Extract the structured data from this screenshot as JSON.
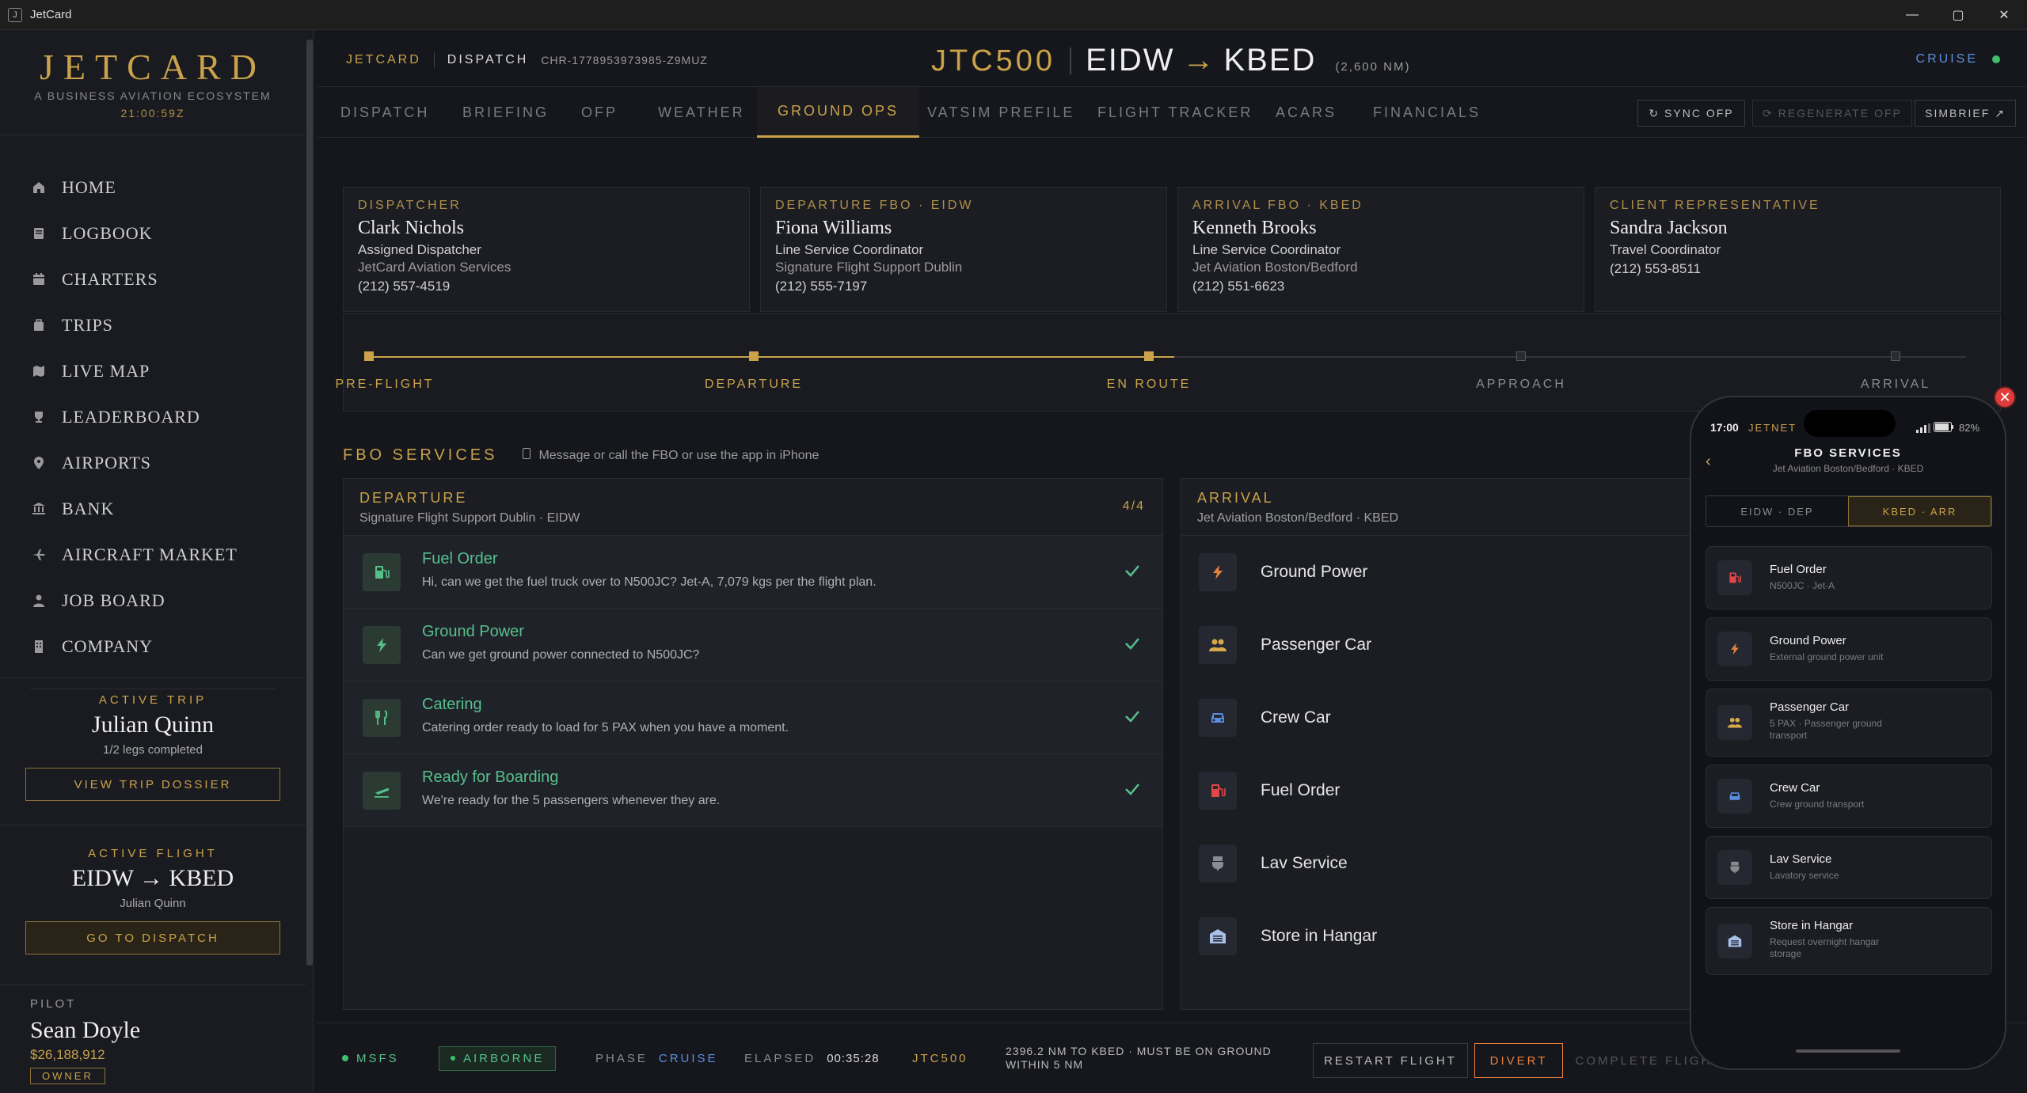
{
  "window": {
    "title": "JetCard"
  },
  "sidebar": {
    "logo": "JETCARD",
    "tagline": "A BUSINESS AVIATION ECOSYSTEM",
    "clock": "21:00:59Z",
    "nav": [
      {
        "label": "HOME",
        "icon": "home-icon"
      },
      {
        "label": "LOGBOOK",
        "icon": "book-icon"
      },
      {
        "label": "CHARTERS",
        "icon": "calendar-icon"
      },
      {
        "label": "TRIPS",
        "icon": "luggage-icon"
      },
      {
        "label": "LIVE MAP",
        "icon": "map-icon"
      },
      {
        "label": "LEADERBOARD",
        "icon": "trophy-icon"
      },
      {
        "label": "AIRPORTS",
        "icon": "pin-icon"
      },
      {
        "label": "BANK",
        "icon": "bank-icon"
      },
      {
        "label": "AIRCRAFT MARKET",
        "icon": "plane-icon"
      },
      {
        "label": "JOB BOARD",
        "icon": "person-icon"
      },
      {
        "label": "COMPANY",
        "icon": "building-icon"
      }
    ],
    "active_trip": {
      "caption": "ACTIVE TRIP",
      "name": "Julian Quinn",
      "legs": "1/2 legs completed",
      "button": "VIEW TRIP DOSSIER"
    },
    "active_flight": {
      "caption": "ACTIVE FLIGHT",
      "route": "EIDW → KBED",
      "pax": "Julian Quinn",
      "button": "GO TO DISPATCH"
    },
    "pilot": {
      "caption": "PILOT",
      "name": "Sean Doyle",
      "balance": "$26,188,912",
      "role": "OWNER"
    }
  },
  "header": {
    "crumb1": "JETCARD",
    "crumb2": "DISPATCH",
    "charter_id": "CHR-1778953973985-Z9MUZ",
    "callsign": "JTC500",
    "origin": "EIDW",
    "arrow": "→",
    "dest": "KBED",
    "distance": "(2,600 NM)",
    "phase": "CRUISE"
  },
  "tabs": [
    "DISPATCH",
    "BRIEFING",
    "OFP",
    "WEATHER",
    "GROUND OPS",
    "VATSIM PREFILE",
    "FLIGHT TRACKER",
    "ACARS",
    "FINANCIALS"
  ],
  "tab_buttons": {
    "sync": "↻ SYNC OFP",
    "regen": "⟳ REGENERATE OFP",
    "simbrief": "SIMBRIEF ↗"
  },
  "contacts": [
    {
      "caption": "DISPATCHER",
      "name": "Clark Nichols",
      "role": "Assigned Dispatcher",
      "org": "JetCard Aviation Services",
      "phone": "(212) 557-4519"
    },
    {
      "caption": "DEPARTURE FBO · EIDW",
      "name": "Fiona Williams",
      "role": "Line Service Coordinator",
      "org": "Signature Flight Support Dublin",
      "phone": "(212) 555-7197"
    },
    {
      "caption": "ARRIVAL FBO · KBED",
      "name": "Kenneth Brooks",
      "role": "Line Service Coordinator",
      "org": "Jet Aviation Boston/Bedford",
      "phone": "(212) 551-6623"
    },
    {
      "caption": "CLIENT REPRESENTATIVE",
      "name": "Sandra Jackson",
      "role": "Travel Coordinator",
      "org": "",
      "phone": "(212) 553-8511"
    }
  ],
  "progress": {
    "stages": [
      "PRE-FLIGHT",
      "DEPARTURE",
      "EN ROUTE",
      "APPROACH",
      "ARRIVAL"
    ],
    "completed_through": 3
  },
  "fbo": {
    "title": "FBO SERVICES",
    "note": "Message or call the FBO or use the app in iPhone",
    "departure": {
      "title": "DEPARTURE",
      "subtitle": "Signature Flight Support Dublin · EIDW",
      "count": "4/4",
      "items": [
        {
          "title": "Fuel Order",
          "desc": "Hi, can we get the fuel truck over to N500JC? Jet-A, 7,079 kgs per the flight plan.",
          "icon": "fuel-icon"
        },
        {
          "title": "Ground Power",
          "desc": "Can we get ground power connected to N500JC?",
          "icon": "bolt-icon"
        },
        {
          "title": "Catering",
          "desc": "Catering order ready to load for 5 PAX when you have a moment.",
          "icon": "utensils-icon"
        },
        {
          "title": "Ready for Boarding",
          "desc": "We're ready for the 5 passengers whenever they are.",
          "icon": "departure-icon"
        }
      ]
    },
    "arrival": {
      "title": "ARRIVAL",
      "subtitle": "Jet Aviation Boston/Bedford · KBED",
      "items": [
        {
          "title": "Ground Power",
          "icon": "bolt-icon"
        },
        {
          "title": "Passenger Car",
          "icon": "people-icon"
        },
        {
          "title": "Crew Car",
          "icon": "car-icon"
        },
        {
          "title": "Fuel Order",
          "icon": "fuel-icon"
        },
        {
          "title": "Lav Service",
          "icon": "toilet-icon"
        },
        {
          "title": "Store in Hangar",
          "icon": "hangar-icon"
        }
      ]
    }
  },
  "status_bar": {
    "sim": "MSFS",
    "airborne": "AIRBORNE",
    "phase_label": "PHASE",
    "phase": "CRUISE",
    "elapsed_label": "ELAPSED",
    "elapsed": "00:35:28",
    "callsign": "JTC500",
    "remaining_line1": "2396.2 NM TO KBED · MUST BE ON GROUND",
    "remaining_line2": "WITHIN 5 NM",
    "restart": "RESTART FLIGHT",
    "divert": "DIVERT",
    "complete": "COMPLETE FLIGHT"
  },
  "phone": {
    "time": "17:00",
    "carrier": "JETNET",
    "battery": "82%",
    "title": "FBO SERVICES",
    "subtitle": "Jet Aviation Boston/Bedford · KBED",
    "seg_dep": "EIDW · DEP",
    "seg_arr": "KBED · ARR",
    "items": [
      {
        "title": "Fuel Order",
        "desc": "N500JC · Jet-A",
        "icon": "fuel-icon"
      },
      {
        "title": "Ground Power",
        "desc": "External ground power unit",
        "icon": "bolt-icon"
      },
      {
        "title": "Passenger Car",
        "desc": "5 PAX · Passenger ground transport",
        "icon": "people-icon"
      },
      {
        "title": "Crew Car",
        "desc": "Crew ground transport",
        "icon": "car-icon"
      },
      {
        "title": "Lav Service",
        "desc": "Lavatory service",
        "icon": "toilet-icon"
      },
      {
        "title": "Store in Hangar",
        "desc": "Request overnight hangar storage",
        "icon": "hangar-icon"
      }
    ]
  },
  "colors": {
    "gold": "#c9a24a",
    "green": "#56c08a",
    "blue": "#5a8fe0",
    "red": "#e04848"
  }
}
